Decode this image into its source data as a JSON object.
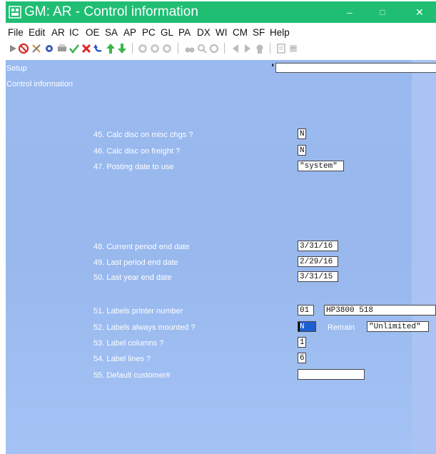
{
  "window": {
    "title": "GM: AR - Control information",
    "minimize": "–",
    "maximize": "□",
    "close": "✕",
    "accent": "#1fbe73",
    "background": "#99b9ef"
  },
  "menu": [
    "File",
    "Edit",
    "AR",
    "IC",
    "OE",
    "SA",
    "AP",
    "PC",
    "GL",
    "PA",
    "DX",
    "WI",
    "CM",
    "SF",
    "Help"
  ],
  "toolbar": {
    "icons": [
      "play-icon",
      "stop-icon",
      "tools-icon",
      "gear-icon",
      "printer-icon",
      "check-icon",
      "cancel-icon",
      "undo-icon",
      "arrow-up-icon",
      "arrow-down-icon",
      "record-first-icon",
      "record-middle-icon",
      "record-last-icon",
      "binoculars-icon",
      "zoom-icon",
      "refresh-icon",
      "previous-icon",
      "next-icon",
      "search-icon",
      "notes-icon",
      "settings-icon"
    ]
  },
  "breadcrumb": {
    "setup": "Setup",
    "screen": "Control information"
  },
  "fields": {
    "f45": {
      "label": "45. Calc disc on misc chgs ?",
      "value": "N"
    },
    "f46": {
      "label": "46. Calc disc on freight ?",
      "value": "N"
    },
    "f47": {
      "label": "47. Posting date to use",
      "value": "\"system\""
    },
    "f48": {
      "label": "48. Current period end date",
      "value": "3/31/16"
    },
    "f49": {
      "label": "49. Last period end date",
      "value": "2/29/16"
    },
    "f50": {
      "label": "50. Last year end date",
      "value": "3/31/15"
    },
    "f51": {
      "label": "51. Labels printer number",
      "value": "01",
      "printer_name": "HP3800 518"
    },
    "f52": {
      "label": "52. Labels always mounted ?",
      "value": "N",
      "remain_label": "Remain",
      "remain_value": "\"Unlimited\""
    },
    "f53": {
      "label": "53. Label columns ?",
      "value": "1"
    },
    "f54": {
      "label": "54. Label lines ?",
      "value": "6"
    },
    "f55": {
      "label": "55. Default customer#",
      "value": ""
    }
  }
}
